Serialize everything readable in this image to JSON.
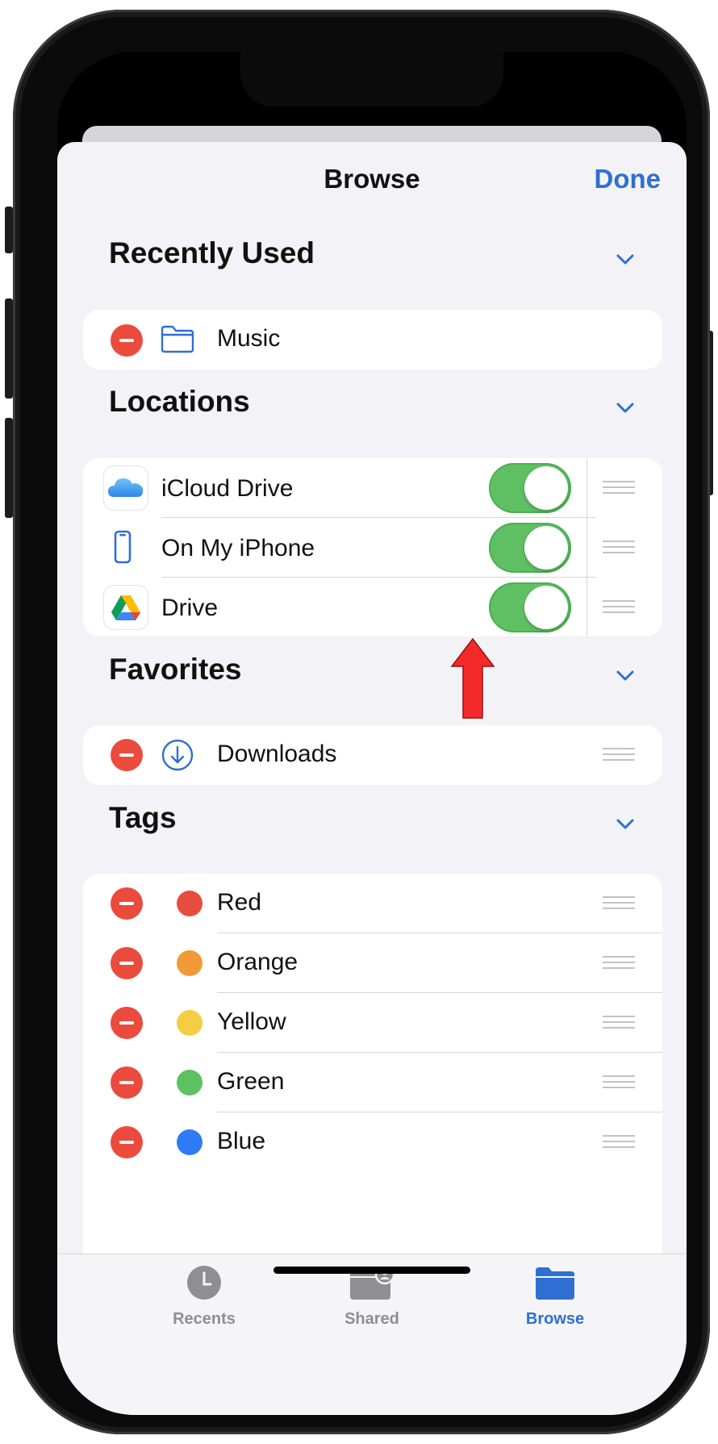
{
  "nav": {
    "title": "Browse",
    "done_label": "Done"
  },
  "sections": {
    "recently_used": {
      "title": "Recently Used",
      "items": [
        {
          "label": "Music",
          "icon": "folder-icon"
        }
      ]
    },
    "locations": {
      "title": "Locations",
      "items": [
        {
          "label": "iCloud Drive",
          "icon": "icloud-icon",
          "enabled": true
        },
        {
          "label": "On My iPhone",
          "icon": "iphone-icon",
          "enabled": true
        },
        {
          "label": "Drive",
          "icon": "google-drive-icon",
          "enabled": true
        }
      ]
    },
    "favorites": {
      "title": "Favorites",
      "items": [
        {
          "label": "Downloads",
          "icon": "download-icon"
        }
      ]
    },
    "tags": {
      "title": "Tags",
      "items": [
        {
          "label": "Red",
          "color": "#e84c3d"
        },
        {
          "label": "Orange",
          "color": "#f19a37"
        },
        {
          "label": "Yellow",
          "color": "#f5cd44"
        },
        {
          "label": "Green",
          "color": "#5cc160"
        },
        {
          "label": "Blue",
          "color": "#2f7bf5"
        }
      ]
    }
  },
  "tabbar": {
    "tabs": [
      {
        "label": "Recents",
        "icon": "clock-icon",
        "active": false
      },
      {
        "label": "Shared",
        "icon": "shared-folder-icon",
        "active": false
      },
      {
        "label": "Browse",
        "icon": "folder-icon",
        "active": true
      }
    ]
  },
  "colors": {
    "accent": "#2f6fd3",
    "toggle_on": "#5ec062",
    "delete": "#eb4b3d",
    "annotation_arrow": "#f42a2a"
  }
}
